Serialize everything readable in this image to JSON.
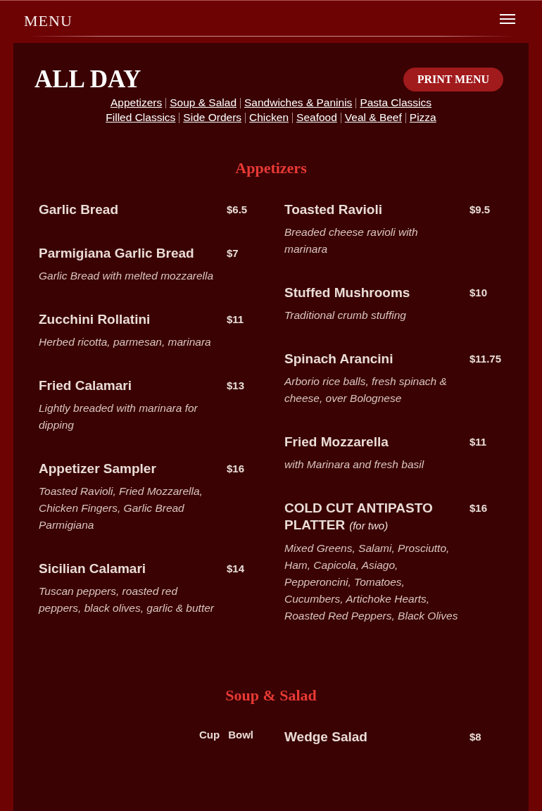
{
  "header": {
    "title": "MENU"
  },
  "page": {
    "title": "ALL DAY",
    "print_button": "PRINT MENU"
  },
  "nav_links": [
    [
      "Appetizers",
      "Soup & Salad",
      "Sandwiches & Paninis",
      "Pasta Classics"
    ],
    [
      "Filled Classics",
      "Side Orders",
      "Chicken",
      "Seafood",
      "Veal & Beef",
      "Pizza"
    ]
  ],
  "sections": [
    {
      "title": "Appetizers",
      "left": {
        "items": [
          {
            "name": "Garlic Bread",
            "price": "$6.5"
          },
          {
            "name": "Parmigiana Garlic Bread",
            "price": "$7",
            "description": "Garlic Bread with melted mozzarella"
          },
          {
            "name": "Zucchini Rollatini",
            "price": "$11",
            "description": "Herbed ricotta, parmesan, marinara"
          },
          {
            "name": "Fried Calamari",
            "price": "$13",
            "description": "Lightly breaded with marinara for dipping"
          },
          {
            "name": "Appetizer Sampler",
            "price": "$16",
            "description": "Toasted Ravioli, Fried Mozzarella, Chicken Fingers, Garlic Bread Parmigiana"
          },
          {
            "name": "Sicilian Calamari",
            "price": "$14",
            "description": "Tuscan peppers, roasted red peppers, black olives, garlic & butter"
          }
        ]
      },
      "right": {
        "items": [
          {
            "name": "Toasted Ravioli",
            "price": "$9.5",
            "description": "Breaded cheese ravioli with marinara"
          },
          {
            "name": "Stuffed Mushrooms",
            "price": "$10",
            "description": "Traditional crumb stuffing"
          },
          {
            "name": "Spinach Arancini",
            "price": "$11.75",
            "description": "Arborio rice balls, fresh spinach & cheese, over Bolognese"
          },
          {
            "name": "Fried Mozzarella",
            "price": "$11",
            "description": "with Marinara and fresh basil"
          },
          {
            "name": "COLD CUT ANTIPASTO PLATTER",
            "note": "(for two)",
            "price": "$16",
            "description": "Mixed Greens, Salami, Prosciutto, Ham, Capicola, Asiago, Pepperoncini, Tomatoes, Cucumbers, Artichoke Hearts, Roasted Red Peppers, Black Olives"
          }
        ]
      }
    },
    {
      "title": "Soup & Salad",
      "left": {
        "size_headers": [
          "Cup",
          "Bowl"
        ]
      },
      "right": {
        "items": [
          {
            "name": "Wedge Salad",
            "price": "$8"
          }
        ]
      }
    }
  ]
}
